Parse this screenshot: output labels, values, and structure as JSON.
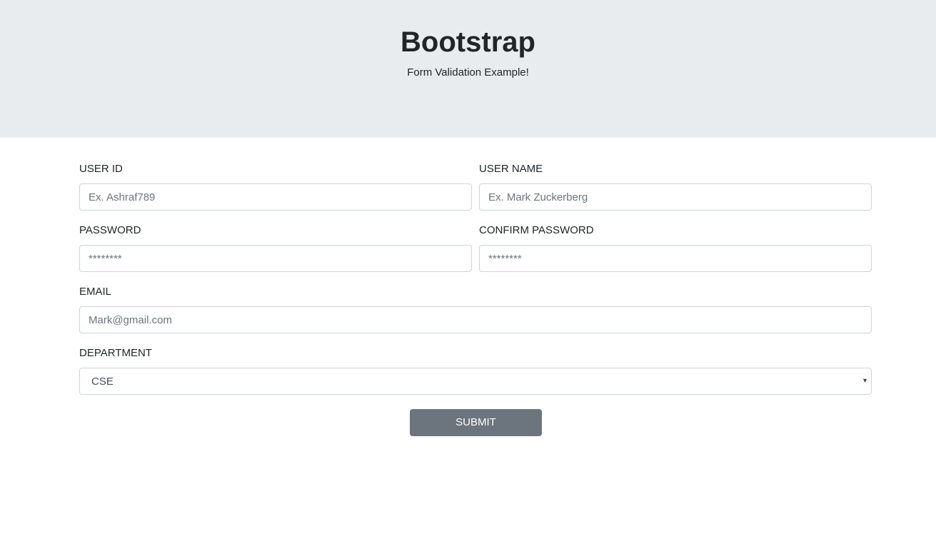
{
  "header": {
    "title": "Bootstrap",
    "subtitle": "Form Validation Example!"
  },
  "form": {
    "user_id": {
      "label": "USER ID",
      "placeholder": "Ex. Ashraf789"
    },
    "user_name": {
      "label": "USER NAME",
      "placeholder": "Ex. Mark Zuckerberg"
    },
    "password": {
      "label": "PASSWORD",
      "placeholder": "********"
    },
    "confirm_password": {
      "label": "CONFIRM PASSWORD",
      "placeholder": "********"
    },
    "email": {
      "label": "EMAIL",
      "placeholder": "Mark@gmail.com"
    },
    "department": {
      "label": "DEPARTMENT",
      "selected": "CSE",
      "caret_icon": "▾"
    },
    "submit_label": "SUBMIT"
  },
  "colors": {
    "header_bg": "#e9ecef",
    "button_bg": "#6c757d",
    "border": "#ced4da"
  }
}
